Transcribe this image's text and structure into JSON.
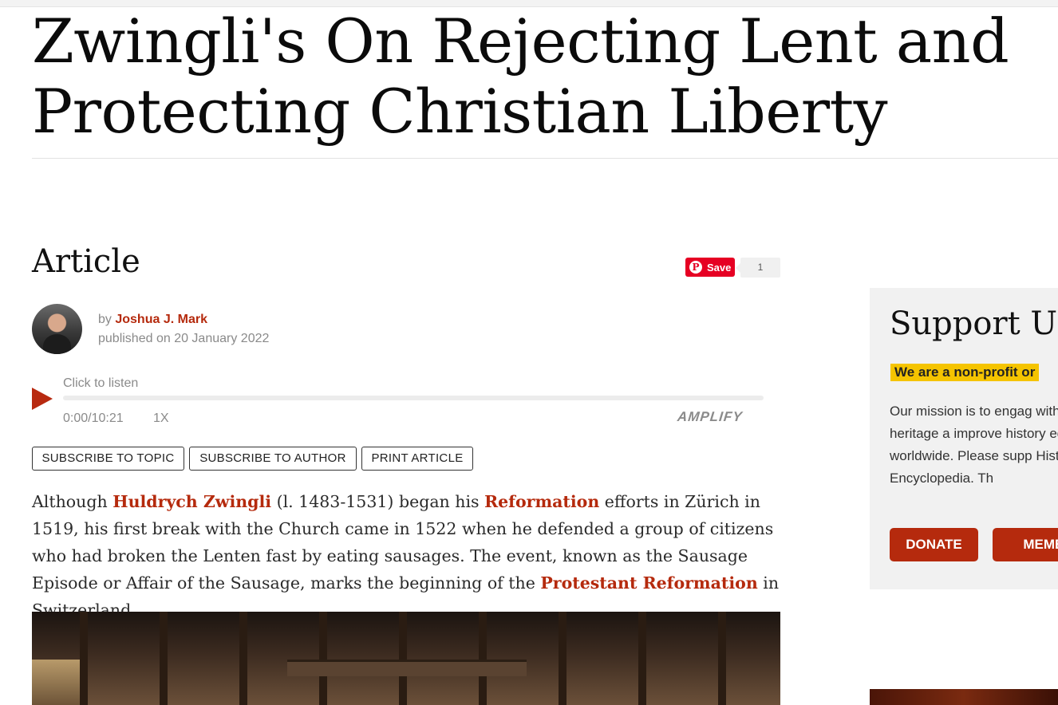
{
  "page": {
    "title": "Zwingli's On Rejecting Lent and Protecting Christian Liberty",
    "section_heading": "Article"
  },
  "pinterest": {
    "save_label": "Save",
    "count": "1",
    "brand_color": "#e60023"
  },
  "author": {
    "by_prefix": "by",
    "name": "Joshua J. Mark",
    "published": "published on 20 January 2022"
  },
  "audio_player": {
    "prompt": "Click to listen",
    "time": "0:00/10:21",
    "speed": "1X",
    "progress_fraction": 0,
    "brand": "AMPLIFY",
    "play_icon": "play-icon"
  },
  "actions": [
    {
      "label": "SUBSCRIBE TO TOPIC"
    },
    {
      "label": "SUBSCRIBE TO AUTHOR"
    },
    {
      "label": "PRINT ARTICLE"
    }
  ],
  "intro": {
    "t1": "Although ",
    "link1": "Huldrych Zwingli",
    "t2": " (l. 1483-1531) began his ",
    "link2": "Reformation",
    "t3": " efforts in Zürich in 1519, his first break with the Church came in 1522 when he defended a group of citizens who had broken the Lenten fast by eating sausages. The event, known as the Sausage Episode or Affair of the Sausage, marks the beginning of the ",
    "link3": "Protestant Reformation",
    "t4": " in Switzerland."
  },
  "sidebar": {
    "title": "Support Us",
    "tag": "We are a non-profit or",
    "text": "Our mission is to engag with cultural heritage a improve history educat worldwide. Please supp History Encyclopedia. Th",
    "donate_label": "DONATE",
    "member_label": "MEMBE"
  },
  "colors": {
    "accent": "#b52a0d",
    "highlight": "#f5c400",
    "sidebar_bg": "#f1f1f1"
  }
}
